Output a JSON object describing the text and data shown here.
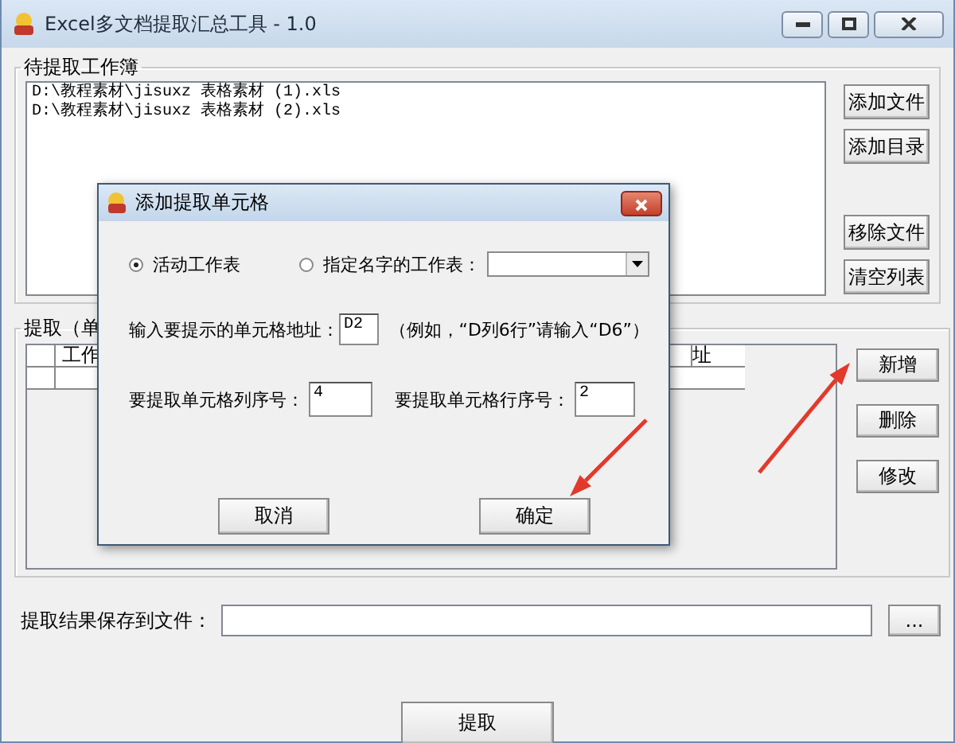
{
  "window": {
    "title": "Excel多文档提取汇总工具 - 1.0"
  },
  "workbooks": {
    "label": "待提取工作簿",
    "files": [
      "D:\\教程素材\\jisuxz 表格素材 (1).xls",
      "D:\\教程素材\\jisuxz 表格素材 (2).xls"
    ],
    "buttons": [
      "添加文件",
      "添加目录",
      "移除文件",
      "清空列表"
    ]
  },
  "extract": {
    "label": "提取（单",
    "columns": [
      "工作",
      "址"
    ],
    "buttons": [
      "新增",
      "删除",
      "修改"
    ]
  },
  "save": {
    "label": "提取结果保存到文件：",
    "browse": "..."
  },
  "run_button": "提取",
  "dialog": {
    "title": "添加提取单元格",
    "sheet_options": [
      {
        "label": "活动工作表",
        "selected": true
      },
      {
        "label": "指定名字的工作表：",
        "selected": false
      }
    ],
    "address": {
      "label": "输入要提示的单元格地址：",
      "value": "D2",
      "hint": "（例如，“D列6行”请输入“D6”）"
    },
    "column": {
      "label": "要提取单元格列序号：",
      "value": "4"
    },
    "row": {
      "label": "要提取单元格行序号：",
      "value": "2"
    },
    "buttons": [
      "取消",
      "确定"
    ]
  },
  "annotations": [
    {
      "kind": "arrow"
    },
    {
      "kind": "arrow"
    }
  ]
}
